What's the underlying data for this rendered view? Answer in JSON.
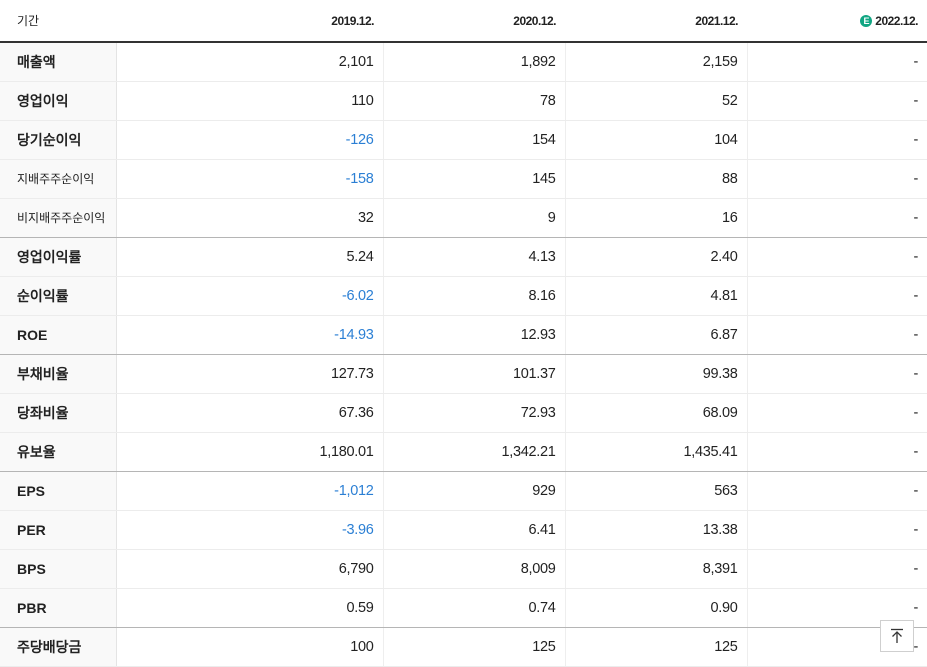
{
  "header": {
    "period_label": "기간",
    "periods": [
      "2019.12.",
      "2020.12.",
      "2021.12.",
      "2022.12."
    ],
    "estimate_icon": "estimate-icon",
    "estimate_glyph": "E"
  },
  "rows": [
    {
      "label": "매출액",
      "values": [
        "2,101",
        "1,892",
        "2,159",
        "-"
      ]
    },
    {
      "label": "영업이익",
      "values": [
        "110",
        "78",
        "52",
        "-"
      ]
    },
    {
      "label": "당기순이익",
      "values": [
        "-126",
        "154",
        "104",
        "-"
      ]
    },
    {
      "label": "지배주주순이익",
      "values": [
        "-158",
        "145",
        "88",
        "-"
      ]
    },
    {
      "label": "비지배주주순이익",
      "values": [
        "32",
        "9",
        "16",
        "-"
      ]
    },
    {
      "label": "영업이익률",
      "values": [
        "5.24",
        "4.13",
        "2.40",
        "-"
      ]
    },
    {
      "label": "순이익률",
      "values": [
        "-6.02",
        "8.16",
        "4.81",
        "-"
      ]
    },
    {
      "label": "ROE",
      "values": [
        "-14.93",
        "12.93",
        "6.87",
        "-"
      ]
    },
    {
      "label": "부채비율",
      "values": [
        "127.73",
        "101.37",
        "99.38",
        "-"
      ]
    },
    {
      "label": "당좌비율",
      "values": [
        "67.36",
        "72.93",
        "68.09",
        "-"
      ]
    },
    {
      "label": "유보율",
      "values": [
        "1,180.01",
        "1,342.21",
        "1,435.41",
        "-"
      ]
    },
    {
      "label": "EPS",
      "values": [
        "-1,012",
        "929",
        "563",
        "-"
      ]
    },
    {
      "label": "PER",
      "values": [
        "-3.96",
        "6.41",
        "13.38",
        "-"
      ]
    },
    {
      "label": "BPS",
      "values": [
        "6,790",
        "8,009",
        "8,391",
        "-"
      ]
    },
    {
      "label": "PBR",
      "values": [
        "0.59",
        "0.74",
        "0.90",
        "-"
      ]
    },
    {
      "label": "주당배당금",
      "values": [
        "100",
        "125",
        "125",
        "-"
      ]
    }
  ],
  "colors": {
    "negative": "#2b7fd4",
    "estimate_badge": "#11a683"
  },
  "scroll_top_icon": "arrow-up-to-top-icon"
}
